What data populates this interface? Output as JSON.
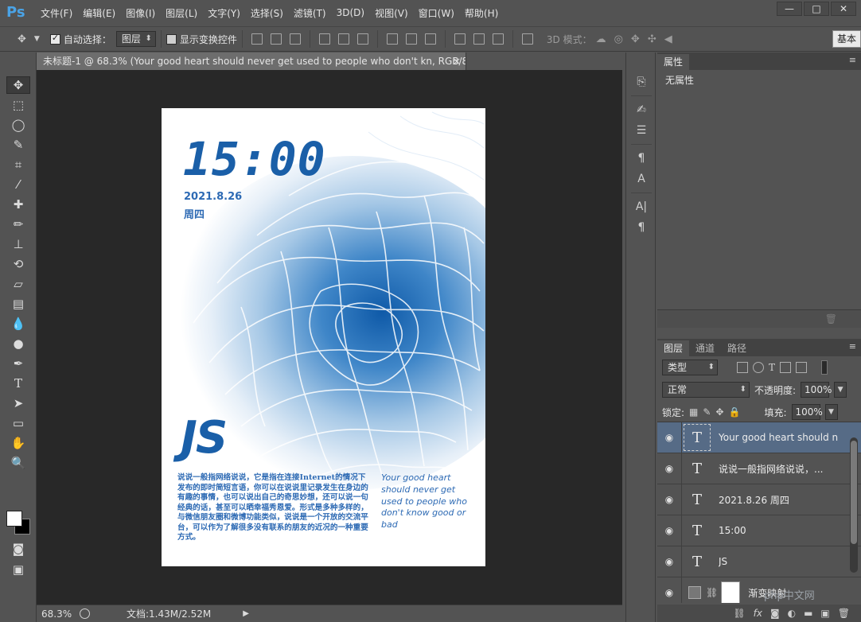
{
  "app": {
    "logo": "Ps"
  },
  "menu": [
    "文件(F)",
    "编辑(E)",
    "图像(I)",
    "图层(L)",
    "文字(Y)",
    "选择(S)",
    "滤镜(T)",
    "3D(D)",
    "视图(V)",
    "窗口(W)",
    "帮助(H)"
  ],
  "window_controls": {
    "minimize": "—",
    "maximize": "□",
    "close": "✕"
  },
  "options": {
    "auto_select_label": "自动选择：",
    "auto_select_value": "图层",
    "show_transform_label": "显示变换控件",
    "mode_3d_label": "3D 模式：",
    "workspace_label": "基本"
  },
  "document": {
    "tab_title": "未标题-1 @ 68.3% (Your good heart  should never get  used to people  who don't kn, RGB/8) *",
    "close": "×"
  },
  "artwork": {
    "time": "15:00",
    "date": "2021.8.26",
    "weekday": "周四",
    "brand": "JS",
    "cn_text": "说说一般指网络说说，它是指在连接Internet的情况下发布的即时简短言语，你可以在说说里记录发生在身边的有趣的事情，也可以说出自己的奇思妙想，还可以说一句经典的话，甚至可以晒幸福秀恩爱。形式是多种多样的，与微信朋友圈和微博功能类似，说说是一个开放的交流平台，可以作为了解很多没有联系的朋友的近况的一种重要方式。",
    "en_text": "Your good heart should never get used to people who don't know good or bad",
    "colors": {
      "accent": "#1a5fa8",
      "text": "#2d6ab4"
    }
  },
  "status": {
    "zoom": "68.3%",
    "doc_size": "文档:1.43M/2.52M",
    "arrow": "▶"
  },
  "properties": {
    "tab": "属性",
    "body": "无属性"
  },
  "layers_panel": {
    "tabs": [
      "图层",
      "通道",
      "路径"
    ],
    "filter_label": "类型",
    "blend_mode": "正常",
    "opacity_label": "不透明度:",
    "opacity_value": "100%",
    "lock_label": "锁定:",
    "fill_label": "填充:",
    "fill_value": "100%",
    "layers": [
      {
        "name": "Your good heart  should n...",
        "type": "T",
        "selected": true
      },
      {
        "name": "说说一般指网络说说，...",
        "type": "T",
        "selected": false
      },
      {
        "name": "2021.8.26 周四",
        "type": "T",
        "selected": false
      },
      {
        "name": "15:00",
        "type": "T",
        "selected": false
      },
      {
        "name": "JS",
        "type": "T",
        "selected": false
      },
      {
        "name": "渐变映射",
        "type": "adjust",
        "selected": false
      }
    ],
    "footer_icons": [
      "link-icon",
      "fx-icon",
      "mask-icon",
      "adjustment-icon",
      "group-icon",
      "new-layer-icon",
      "trash-icon"
    ]
  },
  "watermark": "php中文网"
}
